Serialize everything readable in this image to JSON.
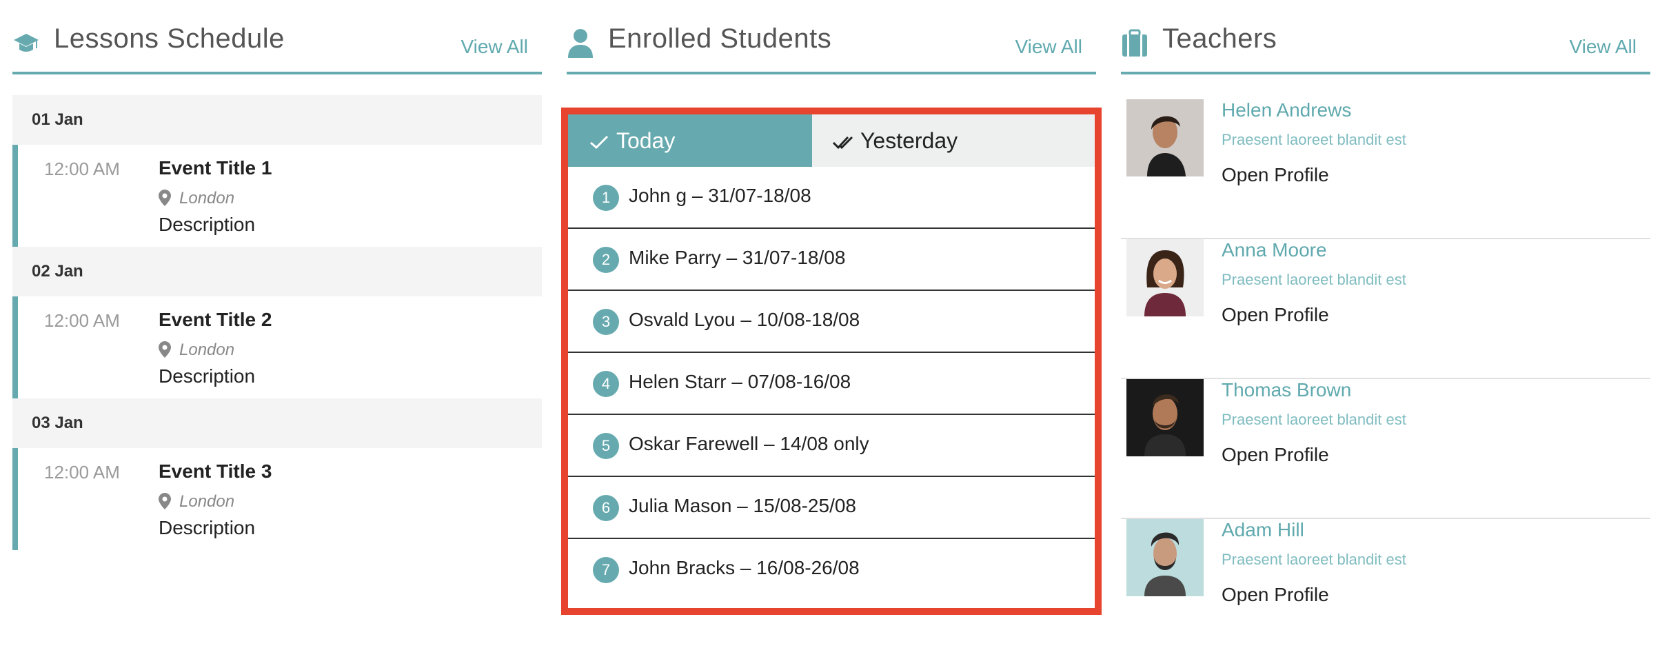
{
  "lessons": {
    "title": "Lessons Schedule",
    "view_all": "View All",
    "days": [
      {
        "date": "01 Jan",
        "time": "12:00 AM",
        "event_title": "Event Title 1",
        "location": "London",
        "description": "Description"
      },
      {
        "date": "02 Jan",
        "time": "12:00 AM",
        "event_title": "Event Title 2",
        "location": "London",
        "description": "Description"
      },
      {
        "date": "03 Jan",
        "time": "12:00 AM",
        "event_title": "Event Title 3",
        "location": "London",
        "description": "Description"
      }
    ]
  },
  "enrolled": {
    "title": "Enrolled Students",
    "view_all": "View All",
    "tabs": [
      {
        "label": "Today",
        "active": true,
        "icon": "check-icon"
      },
      {
        "label": "Yesterday",
        "active": false,
        "icon": "double-check-icon"
      }
    ],
    "students": [
      {
        "num": "1",
        "name": "John g – 31/07-18/08"
      },
      {
        "num": "2",
        "name": "Mike Parry – 31/07-18/08"
      },
      {
        "num": "3",
        "name": "Osvald Lyou – 10/08-18/08"
      },
      {
        "num": "4",
        "name": "Helen Starr – 07/08-16/08"
      },
      {
        "num": "5",
        "name": "Oskar Farewell – 14/08 only"
      },
      {
        "num": "6",
        "name": "Julia Mason – 15/08-25/08"
      },
      {
        "num": "7",
        "name": "John Bracks – 16/08-26/08"
      }
    ]
  },
  "teachers": {
    "title": "Teachers",
    "view_all": "View All",
    "items": [
      {
        "name": "Helen Andrews",
        "subtitle": "Praesent laoreet blandit est",
        "link": "Open Profile"
      },
      {
        "name": "Anna Moore",
        "subtitle": "Praesent laoreet blandit est",
        "link": "Open Profile"
      },
      {
        "name": "Thomas Brown",
        "subtitle": "Praesent laoreet blandit est",
        "link": "Open Profile"
      },
      {
        "name": "Adam Hill",
        "subtitle": "Praesent laoreet blandit est",
        "link": "Open Profile"
      }
    ]
  },
  "colors": {
    "accent": "#66aaaf",
    "highlight_border": "#e74430"
  }
}
